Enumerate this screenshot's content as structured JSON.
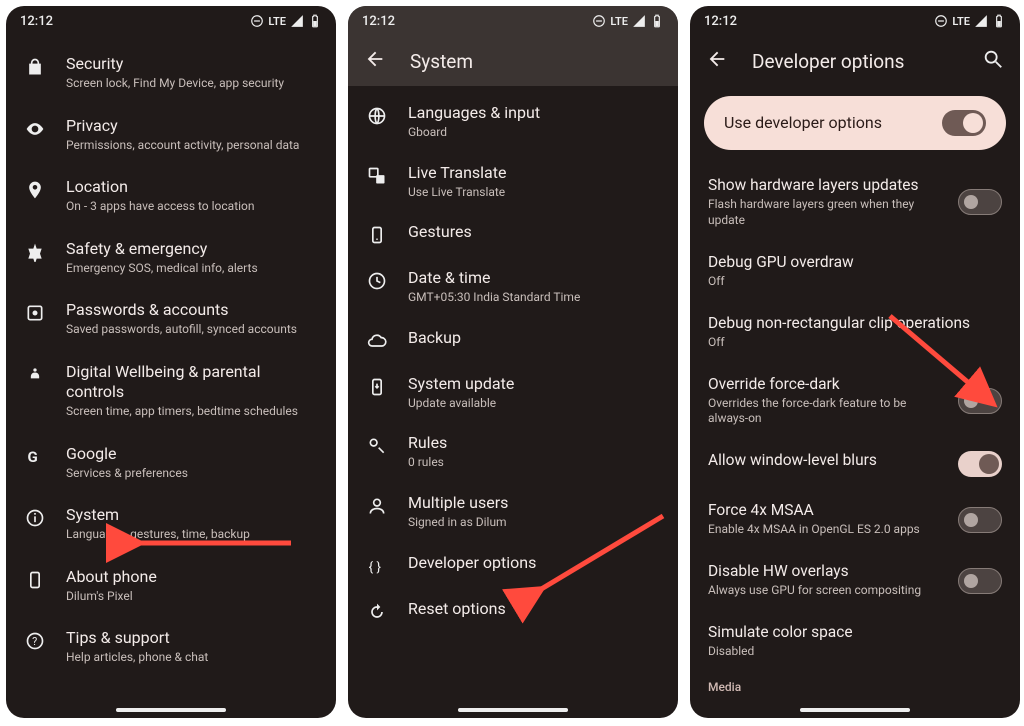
{
  "statusbar": {
    "time": "12:12",
    "net": "LTE"
  },
  "screen1": {
    "items": [
      {
        "title": "Security",
        "sub": "Screen lock, Find My Device, app security"
      },
      {
        "title": "Privacy",
        "sub": "Permissions, account activity, personal data"
      },
      {
        "title": "Location",
        "sub": "On - 3 apps have access to location"
      },
      {
        "title": "Safety & emergency",
        "sub": "Emergency SOS, medical info, alerts"
      },
      {
        "title": "Passwords & accounts",
        "sub": "Saved passwords, autofill, synced accounts"
      },
      {
        "title": "Digital Wellbeing & parental controls",
        "sub": "Screen time, app timers, bedtime schedules"
      },
      {
        "title": "Google",
        "sub": "Services & preferences"
      },
      {
        "title": "System",
        "sub": "Languages, gestures, time, backup"
      },
      {
        "title": "About phone",
        "sub": "Dilum's Pixel"
      },
      {
        "title": "Tips & support",
        "sub": "Help articles, phone & chat"
      }
    ]
  },
  "screen2": {
    "title": "System",
    "items": [
      {
        "title": "Languages & input",
        "sub": "Gboard"
      },
      {
        "title": "Live Translate",
        "sub": "Use Live Translate"
      },
      {
        "title": "Gestures",
        "sub": ""
      },
      {
        "title": "Date & time",
        "sub": "GMT+05:30 India Standard Time"
      },
      {
        "title": "Backup",
        "sub": ""
      },
      {
        "title": "System update",
        "sub": "Update available"
      },
      {
        "title": "Rules",
        "sub": "0 rules"
      },
      {
        "title": "Multiple users",
        "sub": "Signed in as Dilum"
      },
      {
        "title": "Developer options",
        "sub": ""
      },
      {
        "title": "Reset options",
        "sub": ""
      }
    ]
  },
  "screen3": {
    "title": "Developer options",
    "card": "Use developer options",
    "items": [
      {
        "title": "Show hardware layers updates",
        "sub": "Flash hardware layers green when they update",
        "state": "off"
      },
      {
        "title": "Debug GPU overdraw",
        "sub": "Off",
        "state": ""
      },
      {
        "title": "Debug non-rectangular clip operations",
        "sub": "Off",
        "state": ""
      },
      {
        "title": "Override force-dark",
        "sub": "Overrides the force-dark feature to be always-on",
        "state": "off"
      },
      {
        "title": "Allow window-level blurs",
        "sub": "",
        "state": "onlight"
      },
      {
        "title": "Force 4x MSAA",
        "sub": "Enable 4x MSAA in OpenGL ES 2.0 apps",
        "state": "off"
      },
      {
        "title": "Disable HW overlays",
        "sub": "Always use GPU for screen compositing",
        "state": "off"
      },
      {
        "title": "Simulate color space",
        "sub": "Disabled",
        "state": ""
      }
    ],
    "section": "Media"
  }
}
